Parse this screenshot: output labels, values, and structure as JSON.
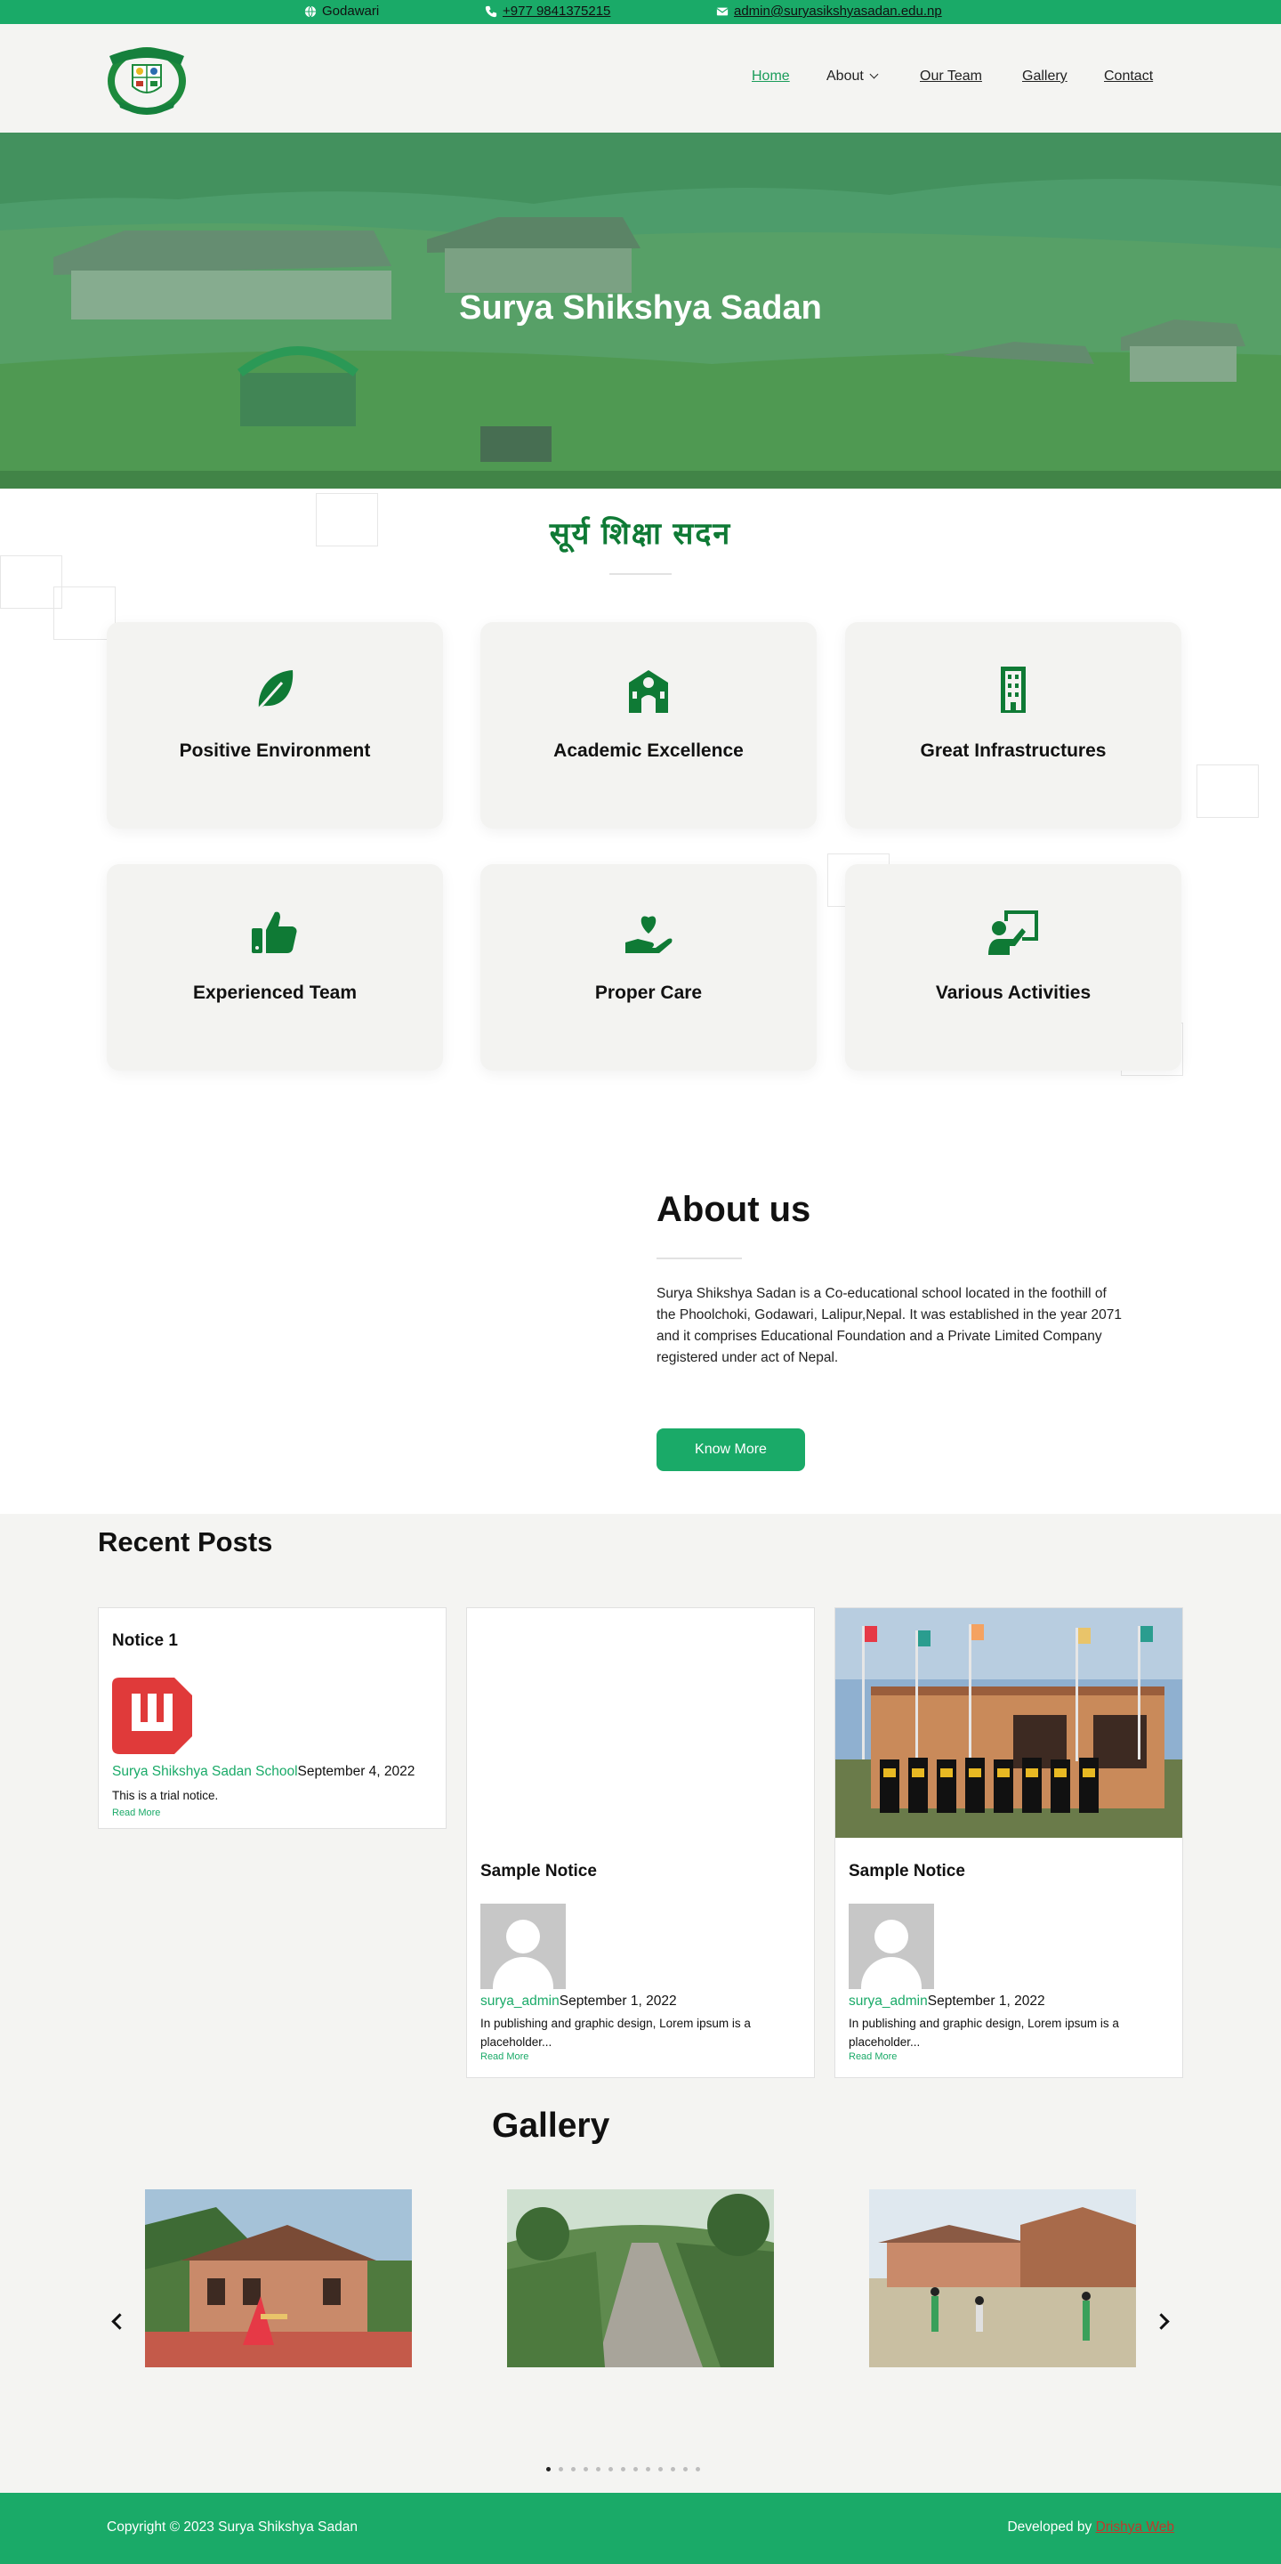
{
  "topbar": {
    "location": "Godawari",
    "phone": "+977 9841375215",
    "email": "admin@suryasikshyasadan.edu.np"
  },
  "nav": {
    "home": "Home",
    "about": "About",
    "team": "Our Team",
    "gallery": "Gallery",
    "contact": "Contact"
  },
  "hero": {
    "title": "Surya Shikshya Sadan"
  },
  "features": {
    "title": "सूर्य शिक्षा सदन",
    "items": [
      {
        "label": "Positive Environment",
        "icon": "leaf-icon"
      },
      {
        "label": "Academic Excellence",
        "icon": "school-icon"
      },
      {
        "label": "Great Infrastructures",
        "icon": "building-icon"
      },
      {
        "label": "Experienced Team",
        "icon": "thumbs-up-icon"
      },
      {
        "label": "Proper Care",
        "icon": "hand-holding-heart-icon"
      },
      {
        "label": "Various Activities",
        "icon": "teacher-board-icon"
      }
    ]
  },
  "about": {
    "heading": "About us",
    "text": "Surya Shikshya Sadan is a Co-educational school located in the foothill of the Phoolchoki, Godawari, Lalipur,Nepal. It was established in the year 2071 and it comprises Educational Foundation and a Private Limited Company registered under act of Nepal.",
    "button": "Know More"
  },
  "posts": {
    "heading": "Recent Posts",
    "items": [
      {
        "title": "Notice 1",
        "author": "Surya Shikshya Sadan School",
        "date": "September 4, 2022",
        "excerpt": "This is a trial notice.",
        "more": "Read More"
      },
      {
        "title": "Sample Notice",
        "author": "surya_admin",
        "date": "September 1, 2022",
        "excerpt": "In publishing and graphic design, Lorem ipsum is a placeholder...",
        "more": "Read More"
      },
      {
        "title": "Sample Notice",
        "author": "surya_admin",
        "date": "September 1, 2022",
        "excerpt": "In publishing and graphic design, Lorem ipsum is a placeholder...",
        "more": "Read More"
      }
    ]
  },
  "gallery": {
    "heading": "Gallery",
    "page_count": 13,
    "current_page": 1
  },
  "footer": {
    "copyright": "Copyright © 2023 Surya Shikshya Sadan",
    "developed_by": "Developed by",
    "developer": "Drishya Web"
  },
  "colors": {
    "brand": "#1aaa68",
    "dark_green": "#0f7a35",
    "link_red": "#c0392b"
  }
}
